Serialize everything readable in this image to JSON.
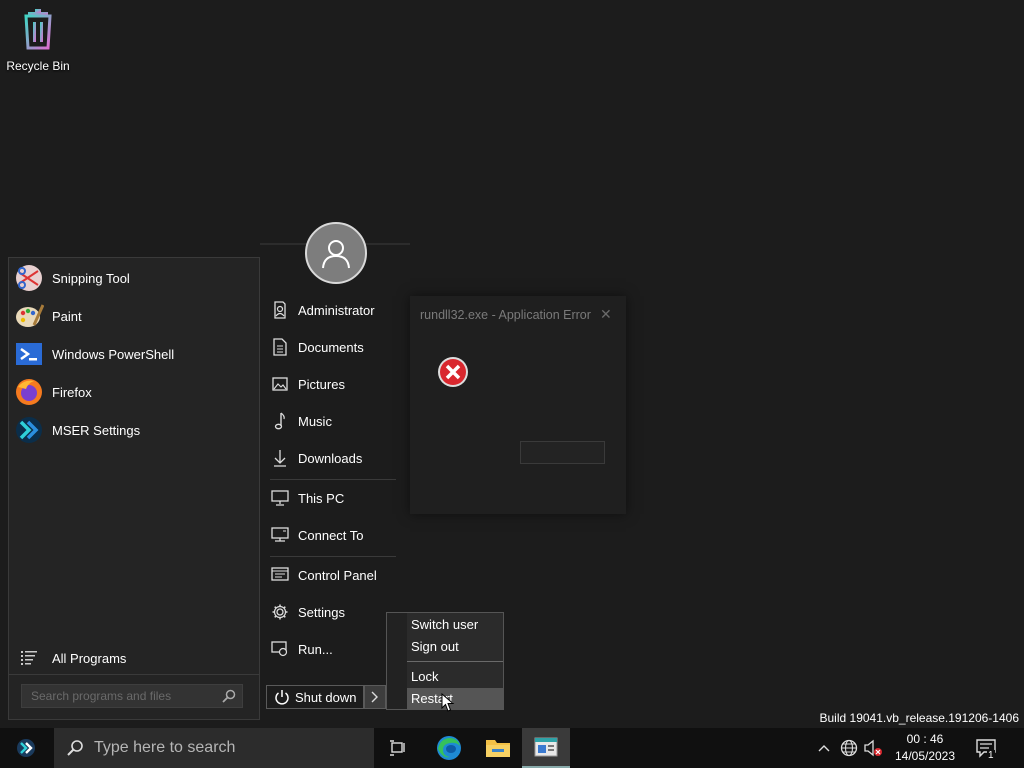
{
  "desktop": {
    "recycle_bin_label": "Recycle Bin"
  },
  "start_menu": {
    "programs": [
      {
        "label": "Snipping Tool",
        "icon": "scissors-icon"
      },
      {
        "label": "Paint",
        "icon": "palette-icon"
      },
      {
        "label": "Windows PowerShell",
        "icon": "powershell-icon"
      },
      {
        "label": "Firefox",
        "icon": "firefox-icon"
      },
      {
        "label": "MSER Settings",
        "icon": "mser-icon"
      }
    ],
    "all_programs_label": "All Programs",
    "search_placeholder": "Search programs and files",
    "right_items": [
      {
        "label": "Administrator",
        "icon": "user-icon"
      },
      {
        "label": "Documents",
        "icon": "document-icon"
      },
      {
        "label": "Pictures",
        "icon": "picture-icon"
      },
      {
        "label": "Music",
        "icon": "music-icon"
      },
      {
        "label": "Downloads",
        "icon": "download-icon"
      },
      {
        "label": "This PC",
        "icon": "computer-icon"
      },
      {
        "label": "Connect To",
        "icon": "connect-icon"
      },
      {
        "label": "Control Panel",
        "icon": "control-panel-icon"
      },
      {
        "label": "Settings",
        "icon": "gear-icon"
      },
      {
        "label": "Run...",
        "icon": "run-icon"
      }
    ],
    "shutdown_label": "Shut down",
    "power_menu": [
      "Switch user",
      "Sign out",
      "Lock",
      "Restart"
    ],
    "power_menu_highlighted": "Restart"
  },
  "dialog": {
    "title": "rundll32.exe - Application Error"
  },
  "build_text": "Build 19041.vb_release.191206-1406",
  "taskbar": {
    "search_placeholder": "Type here to search",
    "clock_time": "00 : 46",
    "clock_date": "14/05/2023",
    "notification_count": "1"
  },
  "colors": {
    "background": "#1c1c1c",
    "taskbar": "#101010",
    "error_red": "#d9272e"
  }
}
